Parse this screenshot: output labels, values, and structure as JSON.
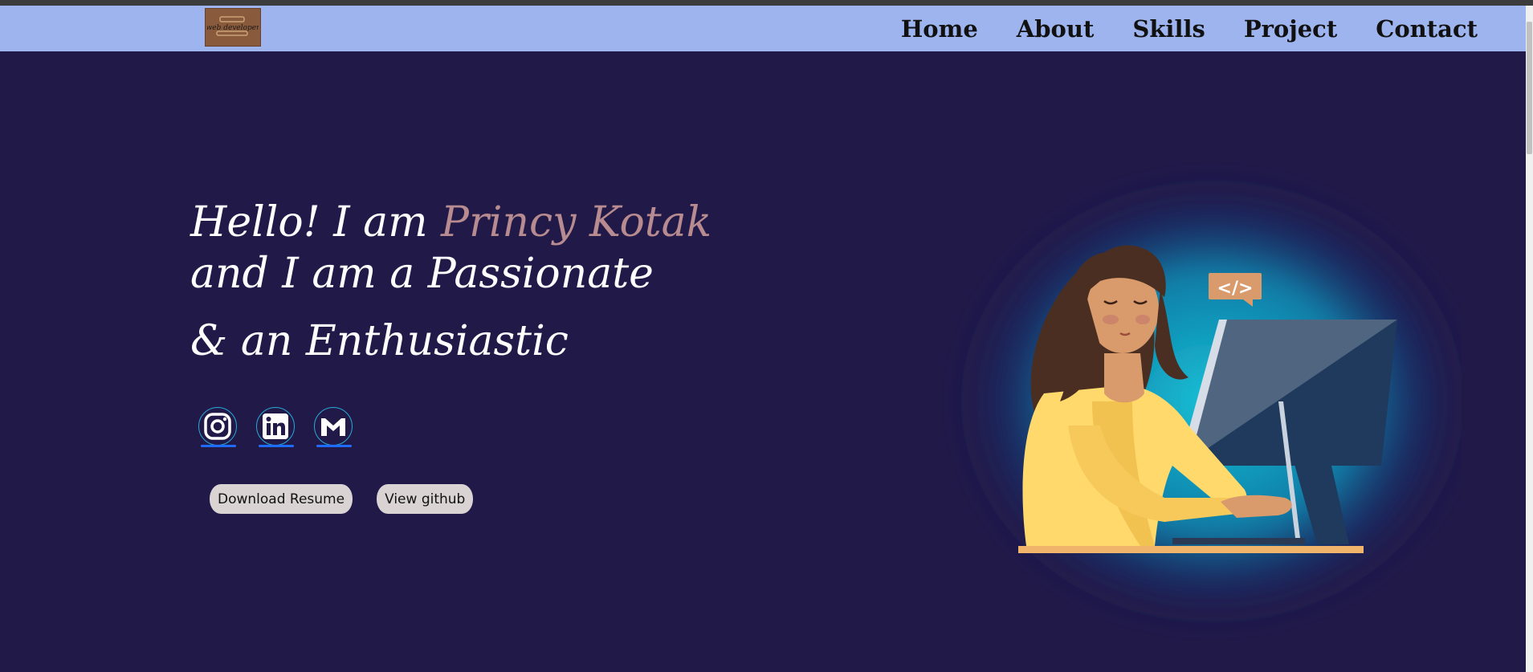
{
  "nav": {
    "logo_text": "web developer",
    "links": [
      "Home",
      "About",
      "Skills",
      "Project",
      "Contact"
    ]
  },
  "hero": {
    "greeting_prefix": "Hello! I am ",
    "name": "Princy Kotak",
    "line2": "and I am a Passionate",
    "line3": "& an Enthusiastic",
    "code_tag": "</>"
  },
  "socials": [
    "instagram-icon",
    "linkedin-icon",
    "gmail-icon"
  ],
  "buttons": {
    "download": "Download Resume",
    "github": "View github"
  },
  "colors": {
    "background": "#211a49",
    "navbar": "#9db4ee",
    "name_accent": "#b78b8f",
    "button_bg": "#d9d3d3",
    "glow": "#16c3d8"
  }
}
